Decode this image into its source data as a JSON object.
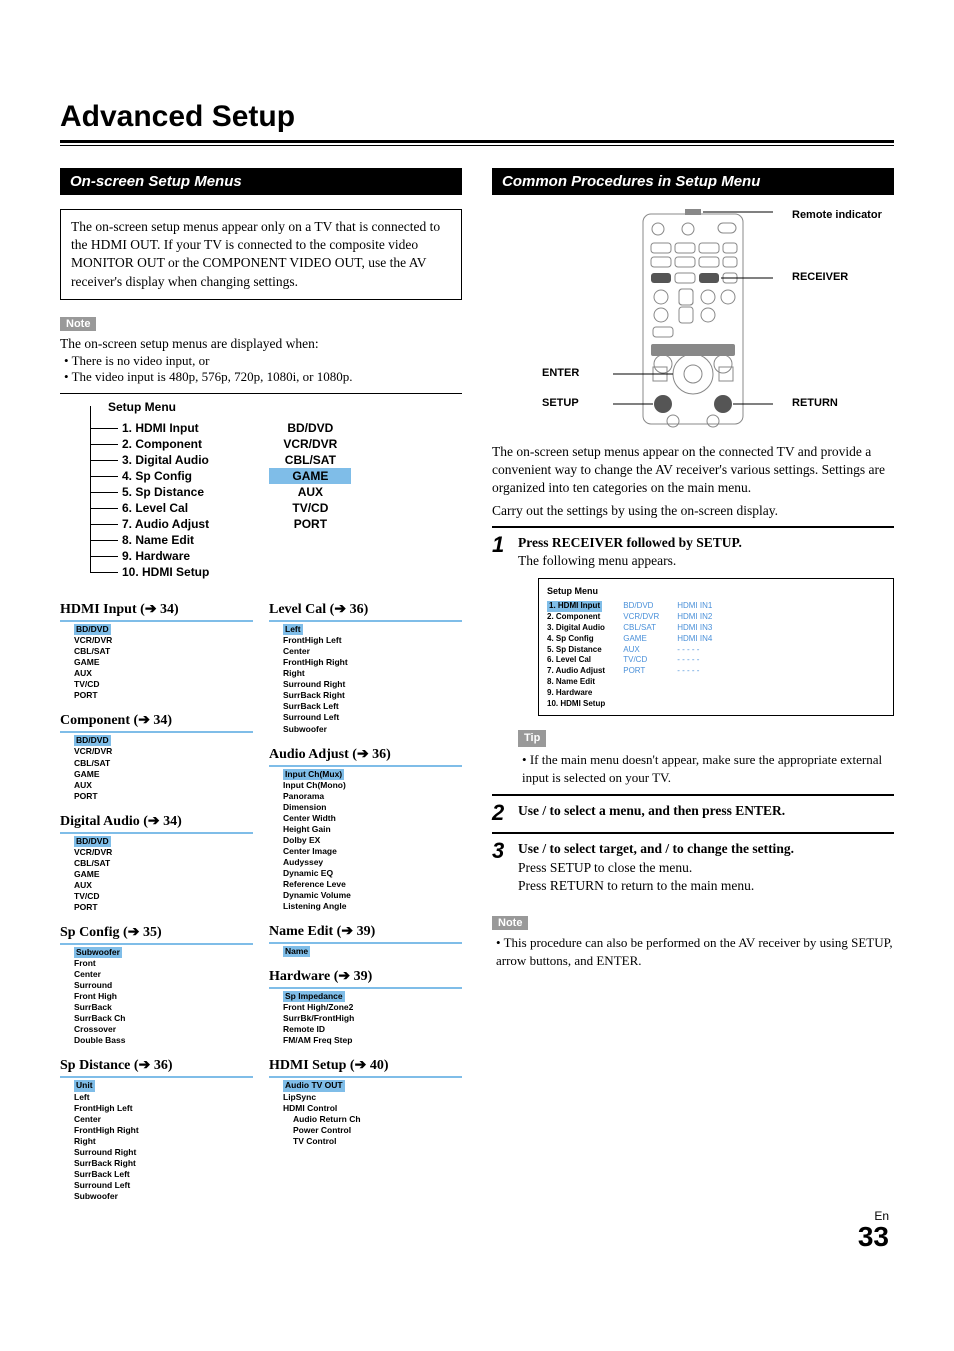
{
  "title": "Advanced Setup",
  "sections": {
    "left": "On-screen Setup Menus",
    "right": "Common Procedures in Setup Menu"
  },
  "intro_box": "The on-screen setup menus appear only on a TV that is connected to the HDMI OUT. If your TV is connected to the composite video MONITOR OUT or the COMPONENT VIDEO OUT, use the AV receiver's display when changing settings.",
  "note_label": "Note",
  "tip_label": "Tip",
  "note1_intro": "The on-screen setup menus are displayed when:",
  "note1_bullets": [
    "There is no video input, or",
    "The video input is 480p, 576p, 720p, 1080i, or 1080p."
  ],
  "setup_menu": {
    "title": "Setup Menu",
    "items": [
      "1. HDMI Input",
      "2. Component",
      "3. Digital Audio",
      "4. Sp Config",
      "5. Sp Distance",
      "6. Level Cal",
      "7. Audio Adjust",
      "8. Name Edit",
      "9. Hardware",
      "10. HDMI Setup"
    ],
    "right": [
      "BD/DVD",
      "VCR/DVR",
      "CBL/SAT",
      "GAME",
      "AUX",
      "TV/CD",
      "PORT"
    ],
    "right_hl_index": 3
  },
  "subsections": {
    "left": [
      {
        "title": "HDMI Input",
        "page": "34",
        "items": [
          "BD/DVD",
          "VCR/DVR",
          "CBL/SAT",
          "GAME",
          "AUX",
          "TV/CD",
          "PORT"
        ]
      },
      {
        "title": "Component",
        "page": "34",
        "items": [
          "BD/DVD",
          "VCR/DVR",
          "CBL/SAT",
          "GAME",
          "AUX",
          "PORT"
        ]
      },
      {
        "title": "Digital Audio",
        "page": "34",
        "items": [
          "BD/DVD",
          "VCR/DVR",
          "CBL/SAT",
          "GAME",
          "AUX",
          "TV/CD",
          "PORT"
        ]
      },
      {
        "title": "Sp Config",
        "page": "35",
        "items": [
          "Subwoofer",
          "Front",
          "Center",
          "Surround",
          "Front High",
          "SurrBack",
          "SurrBack Ch",
          "Crossover",
          "Double Bass"
        ]
      },
      {
        "title": "Sp Distance",
        "page": "36",
        "items": [
          "Unit",
          "Left",
          "FrontHigh Left",
          "Center",
          "FrontHigh Right",
          "Right",
          "Surround Right",
          "SurrBack Right",
          "SurrBack Left",
          "Surround Left",
          "Subwoofer"
        ]
      }
    ],
    "right": [
      {
        "title": "Level Cal",
        "page": "36",
        "items": [
          "Left",
          "FrontHigh Left",
          "Center",
          "FrontHigh Right",
          "Right",
          "Surround Right",
          "SurrBack Right",
          "SurrBack Left",
          "Surround Left",
          "Subwoofer"
        ]
      },
      {
        "title": "Audio Adjust",
        "page": "36",
        "items": [
          "Input Ch(Mux)",
          "Input Ch(Mono)",
          "Panorama",
          "Dimension",
          "Center Width",
          "Height Gain",
          "Dolby EX",
          "Center Image",
          "Audyssey",
          "Dynamic EQ",
          "Reference Leve",
          "Dynamic Volume",
          "Listening Angle"
        ]
      },
      {
        "title": "Name Edit",
        "page": "39",
        "items": [
          "Name"
        ]
      },
      {
        "title": "Hardware",
        "page": "39",
        "items": [
          "Sp Impedance",
          "Front High/Zone2",
          "SurrBk/FrontHigh",
          "Remote ID",
          "FM/AM Freq Step"
        ]
      },
      {
        "title": "HDMI Setup",
        "page": "40",
        "items": [
          "Audio TV OUT",
          "LipSync",
          "HDMI Control",
          "Audio Return Ch",
          "Power Control",
          "TV Control"
        ],
        "indent_from": 3
      }
    ]
  },
  "remote_labels": {
    "indicator": "Remote indicator",
    "receiver": "RECEIVER",
    "enter": "ENTER",
    "setup": "SETUP",
    "return": "RETURN"
  },
  "right_intro": "The on-screen setup menus appear on the connected TV and provide a convenient way to change the AV receiver's various settings. Settings are organized into ten categories on the main menu.",
  "right_intro2": "Carry out the settings by using the on-screen display.",
  "steps": {
    "s1_a": "Press RECEIVER followed by SETUP.",
    "s1_b": "The following menu appears.",
    "s1_tip": "If the main menu doesn't appear, make sure the appropriate external input is selected on your TV.",
    "s2": "Use  /    to select a menu, and then press    ENTER.",
    "s3_a": "Use  /    to select target, and    /        to change the setting.",
    "s3_b": "Press SETUP to close the menu.",
    "s3_c": "Press RETURN to return to the main menu."
  },
  "onscreen": {
    "title": "Setup Menu",
    "c1": [
      "1. HDMI Input",
      "2. Component",
      "3. Digital Audio",
      "4. Sp Config",
      "5. Sp Distance",
      "6. Level Cal",
      "7. Audio Adjust",
      "8. Name Edit",
      "9. Hardware",
      "10. HDMI Setup"
    ],
    "c2": [
      "BD/DVD",
      "VCR/DVR",
      "CBL/SAT",
      "GAME",
      "AUX",
      "TV/CD",
      "PORT"
    ],
    "c3": [
      "HDMI IN1",
      "HDMI IN2",
      "HDMI IN3",
      "HDMI IN4",
      "- - - - -",
      "- - - - -",
      "- - - - -"
    ]
  },
  "bottom_note": "This procedure can also be performed on the AV receiver by using SETUP, arrow buttons, and ENTER.",
  "page": {
    "lang": "En",
    "num": "33"
  }
}
